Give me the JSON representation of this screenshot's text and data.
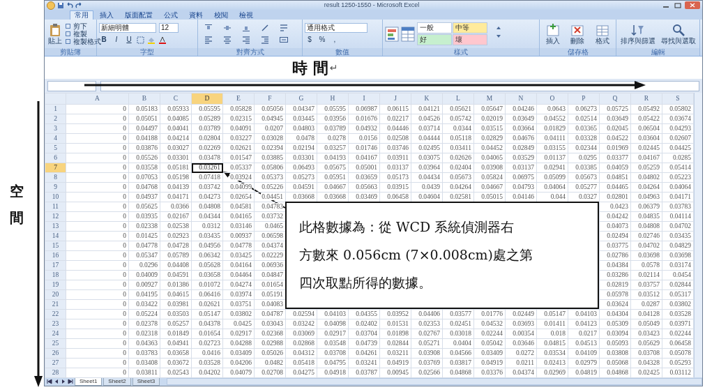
{
  "window": {
    "title": "result 1250-1550 - Microsoft Excel"
  },
  "ribbon": {
    "tabs": [
      {
        "label": "常用",
        "selected": true
      },
      {
        "label": "插入",
        "selected": false
      },
      {
        "label": "版面配置",
        "selected": false
      },
      {
        "label": "公式",
        "selected": false
      },
      {
        "label": "資料",
        "selected": false
      },
      {
        "label": "校閱",
        "selected": false
      },
      {
        "label": "檢視",
        "selected": false
      }
    ],
    "clipboard": {
      "label": "剪貼簿",
      "paste": "貼上",
      "items": [
        "剪下",
        "複製",
        "複製格式"
      ]
    },
    "font": {
      "label": "字型",
      "name": "新細明體",
      "size": "12",
      "styles": [
        "B",
        "I",
        "U"
      ]
    },
    "alignment": {
      "label": "對齊方式"
    },
    "number": {
      "label": "數值",
      "format": "通用格式",
      "symbols": [
        "$",
        "%",
        ","
      ]
    },
    "styles": {
      "label": "樣式",
      "cells": [
        {
          "label": "一般",
          "color": "#ffffff"
        },
        {
          "label": "中等",
          "color": "#ffeb9c"
        },
        {
          "label": "好",
          "color": "#c6efce"
        },
        {
          "label": "壞",
          "color": "#ffc7ce"
        }
      ]
    },
    "cells": {
      "label": "儲存格",
      "buttons": [
        "插入",
        "刪除",
        "格式"
      ]
    },
    "editing": {
      "label": "編輯",
      "buttons": [
        "排序與篩選",
        "尋找與選取"
      ]
    }
  },
  "annotations": {
    "horizontal_label": "時 間",
    "paragraph_mark": "↵",
    "vertical_label": "空間"
  },
  "callout": {
    "lines": [
      "此格數據為：從 WCD 系統偵測器右",
      "方數來 0.056cm (7×0.008cm)處之第",
      "四次取點所得的數據。"
    ]
  },
  "sheet": {
    "columns": [
      {
        "label": "A",
        "selected": false
      },
      {
        "label": "B",
        "selected": false
      },
      {
        "label": "C",
        "selected": false
      },
      {
        "label": "D",
        "selected": true
      },
      {
        "label": "E",
        "selected": false
      },
      {
        "label": "F",
        "selected": false
      },
      {
        "label": "G",
        "selected": false
      },
      {
        "label": "H",
        "selected": false
      },
      {
        "label": "I",
        "selected": false
      },
      {
        "label": "J",
        "selected": false
      },
      {
        "label": "K",
        "selected": false
      },
      {
        "label": "L",
        "selected": false
      },
      {
        "label": "M",
        "selected": false
      },
      {
        "label": "N",
        "selected": false
      },
      {
        "label": "O",
        "selected": false
      },
      {
        "label": "P",
        "selected": false
      },
      {
        "label": "Q",
        "selected": false
      },
      {
        "label": "R",
        "selected": false
      },
      {
        "label": "S",
        "selected": false
      }
    ],
    "rows": [
      {
        "number": "1",
        "selected": false,
        "cells": [
          "0",
          "0.05183",
          "0.05933",
          "0.05595",
          "0.05828",
          "0.05056",
          "0.04347",
          "0.05595",
          "0.06987",
          "0.06115",
          "0.04121",
          "0.05621",
          "0.05647",
          "0.04246",
          "0.0643",
          "0.06273",
          "0.05725",
          "0.05492",
          "0.05802"
        ]
      },
      {
        "number": "2",
        "selected": false,
        "cells": [
          "0",
          "0.05051",
          "0.04085",
          "0.05289",
          "0.02315",
          "0.04945",
          "0.03445",
          "0.03956",
          "0.01676",
          "0.02217",
          "0.04526",
          "0.05742",
          "0.02019",
          "0.03649",
          "0.04552",
          "0.02514",
          "0.03649",
          "0.05422",
          "0.03674"
        ]
      },
      {
        "number": "3",
        "selected": false,
        "cells": [
          "0",
          "0.04497",
          "0.04041",
          "0.03789",
          "0.04091",
          "0.0207",
          "0.04803",
          "0.03789",
          "0.04932",
          "0.04446",
          "0.03714",
          "0.0344",
          "0.03515",
          "0.03664",
          "0.01829",
          "0.03365",
          "0.02045",
          "0.06504",
          "0.04293"
        ]
      },
      {
        "number": "4",
        "selected": false,
        "cells": [
          "0",
          "0.04188",
          "0.04214",
          "0.02804",
          "0.03227",
          "0.03028",
          "0.0478",
          "0.0278",
          "0.0156",
          "0.02508",
          "0.04444",
          "0.05118",
          "0.02829",
          "0.04676",
          "0.04111",
          "0.03328",
          "0.04522",
          "0.03604",
          "0.02607"
        ]
      },
      {
        "number": "5",
        "selected": false,
        "cells": [
          "0",
          "0.03876",
          "0.03027",
          "0.02269",
          "0.02621",
          "0.02394",
          "0.02194",
          "0.03257",
          "0.01746",
          "0.03746",
          "0.02495",
          "0.03411",
          "0.04452",
          "0.02849",
          "0.03155",
          "0.02344",
          "0.01969",
          "0.02445",
          "0.04425"
        ]
      },
      {
        "number": "6",
        "selected": false,
        "cells": [
          "0",
          "0.05526",
          "0.03301",
          "0.03478",
          "0.01547",
          "0.03885",
          "0.03301",
          "0.04193",
          "0.04167",
          "0.03911",
          "0.03075",
          "0.02626",
          "0.04065",
          "0.03529",
          "0.01137",
          "0.0295",
          "0.03377",
          "0.04167",
          "0.0285"
        ]
      },
      {
        "number": "7",
        "selected": true,
        "cells": [
          "0",
          "0.03558",
          "0.05181",
          "0.03261",
          "0.05337",
          "0.05806",
          "0.06493",
          "0.05675",
          "0.05001",
          "0.03137",
          "0.03964",
          "0.02404",
          "0.03908",
          "0.03137",
          "0.02941",
          "0.03385",
          "0.04059",
          "0.05259",
          "0.05414"
        ]
      },
      {
        "number": "8",
        "selected": false,
        "cells": [
          "0",
          "0.07053",
          "0.05198",
          "0.07418",
          "0.03924",
          "0.05373",
          "0.05273",
          "0.05951",
          "0.03659",
          "0.05173",
          "0.04434",
          "0.05673",
          "0.05824",
          "0.06975",
          "0.05099",
          "0.05673",
          "0.04851",
          "0.04802",
          "0.05223"
        ]
      },
      {
        "number": "9",
        "selected": false,
        "cells": [
          "0",
          "0.04768",
          "0.04139",
          "0.03742",
          "0.04099",
          "0.05226",
          "0.04591",
          "0.04667",
          "0.05663",
          "0.03915",
          "0.0439",
          "0.04264",
          "0.04667",
          "0.04793",
          "0.04064",
          "0.05277",
          "0.04465",
          "0.04264",
          "0.04064"
        ]
      },
      {
        "number": "10",
        "selected": false,
        "cells": [
          "0",
          "0.04937",
          "0.04171",
          "0.04273",
          "0.02654",
          "0.04451",
          "0.03668",
          "0.03668",
          "0.03469",
          "0.06458",
          "0.04604",
          "0.02581",
          "0.05015",
          "0.04146",
          "0.044",
          "0.0327",
          "0.02801",
          "0.04963",
          "0.04171"
        ]
      },
      {
        "number": "11",
        "selected": false,
        "cells": [
          "0",
          "0.05625",
          "0.0366",
          "0.04808",
          "0.04581",
          "0.04783",
          null,
          null,
          null,
          null,
          null,
          null,
          null,
          null,
          null,
          null,
          "0.0423",
          "0.06379",
          "0.03783"
        ]
      },
      {
        "number": "12",
        "selected": false,
        "cells": [
          "0",
          "0.03935",
          "0.02167",
          "0.04344",
          "0.04165",
          "0.03732",
          null,
          null,
          null,
          null,
          null,
          null,
          null,
          null,
          null,
          null,
          "0.04242",
          "0.04835",
          "0.04114"
        ]
      },
      {
        "number": "13",
        "selected": false,
        "cells": [
          "0",
          "0.02338",
          "0.02538",
          "0.0312",
          "0.03146",
          "0.0465",
          null,
          null,
          null,
          null,
          null,
          null,
          null,
          null,
          null,
          null,
          "0.04073",
          "0.04808",
          "0.04702"
        ]
      },
      {
        "number": "14",
        "selected": false,
        "cells": [
          "0",
          "0.01425",
          "0.02923",
          "0.03435",
          "0.00937",
          "0.06598",
          null,
          null,
          null,
          null,
          null,
          null,
          null,
          null,
          null,
          null,
          "0.02494",
          "0.02746",
          "0.03435"
        ]
      },
      {
        "number": "15",
        "selected": false,
        "cells": [
          "0",
          "0.04778",
          "0.04728",
          "0.04956",
          "0.04778",
          "0.04374",
          null,
          null,
          null,
          null,
          null,
          null,
          null,
          null,
          null,
          null,
          "0.03775",
          "0.04702",
          "0.04829"
        ]
      },
      {
        "number": "16",
        "selected": false,
        "cells": [
          "0",
          "0.05347",
          "0.05789",
          "0.06342",
          "0.03425",
          "0.02229",
          null,
          null,
          null,
          null,
          null,
          null,
          null,
          null,
          null,
          null,
          "0.02786",
          "0.03698",
          "0.03698"
        ]
      },
      {
        "number": "17",
        "selected": false,
        "cells": [
          "0",
          "0.0296",
          "0.04408",
          "0.05628",
          "0.04164",
          "0.06936",
          null,
          null,
          null,
          null,
          null,
          null,
          null,
          null,
          null,
          null,
          "0.04384",
          "0.0578",
          "0.03174"
        ]
      },
      {
        "number": "18",
        "selected": false,
        "cells": [
          "0",
          "0.04009",
          "0.04591",
          "0.03658",
          "0.04464",
          "0.04847",
          null,
          null,
          null,
          null,
          null,
          null,
          null,
          null,
          null,
          null,
          "0.03286",
          "0.02114",
          "0.0454"
        ]
      },
      {
        "number": "19",
        "selected": false,
        "cells": [
          "0",
          "0.00927",
          "0.01386",
          "0.01072",
          "0.04274",
          "0.01654",
          null,
          null,
          null,
          null,
          null,
          null,
          null,
          null,
          null,
          null,
          "0.02819",
          "0.03757",
          "0.02844"
        ]
      },
      {
        "number": "20",
        "selected": false,
        "cells": [
          "0",
          "0.04195",
          "0.04615",
          "0.06416",
          "0.03974",
          "0.05191",
          null,
          null,
          null,
          null,
          null,
          null,
          null,
          null,
          null,
          null,
          "0.05978",
          "0.03512",
          "0.05317"
        ]
      },
      {
        "number": "21",
        "selected": false,
        "cells": [
          "0",
          "0.03422",
          "0.03981",
          "0.02621",
          "0.03751",
          "0.04083",
          null,
          null,
          null,
          null,
          null,
          null,
          null,
          null,
          null,
          null,
          "0.03624",
          "0.0287",
          "0.03802"
        ]
      },
      {
        "number": "22",
        "selected": false,
        "cells": [
          "0",
          "0.05224",
          "0.03503",
          "0.05147",
          "0.03802",
          "0.04787",
          "0.02594",
          "0.04103",
          "0.04355",
          "0.03952",
          "0.04406",
          "0.03577",
          "0.01776",
          "0.02449",
          "0.05147",
          "0.04103",
          "0.04304",
          "0.04128",
          "0.03528"
        ]
      },
      {
        "number": "23",
        "selected": false,
        "cells": [
          "0",
          "0.02378",
          "0.05257",
          "0.04378",
          "0.0425",
          "0.03043",
          "0.03242",
          "0.04098",
          "0.02402",
          "0.01531",
          "0.02353",
          "0.02451",
          "0.04532",
          "0.03693",
          "0.01411",
          "0.04123",
          "0.05309",
          "0.05049",
          "0.03971"
        ]
      },
      {
        "number": "24",
        "selected": false,
        "cells": [
          "0",
          "0.02318",
          "0.01849",
          "0.01654",
          "0.02917",
          "0.02368",
          "0.03069",
          "0.02917",
          "0.03704",
          "0.01898",
          "0.02767",
          "0.03018",
          "0.02244",
          "0.00354",
          "0.018",
          "0.0217",
          "0.03094",
          "0.03423",
          "0.02244"
        ]
      },
      {
        "number": "25",
        "selected": false,
        "cells": [
          "0",
          "0.04363",
          "0.04941",
          "0.02723",
          "0.04288",
          "0.02988",
          "0.02868",
          "0.03548",
          "0.04739",
          "0.02844",
          "0.05271",
          "0.0404",
          "0.05042",
          "0.03646",
          "0.04815",
          "0.04513",
          "0.05093",
          "0.05629",
          "0.06458"
        ]
      },
      {
        "number": "26",
        "selected": false,
        "cells": [
          "0",
          "0.03783",
          "0.03658",
          "0.0416",
          "0.03409",
          "0.05026",
          "0.04312",
          "0.03708",
          "0.04261",
          "0.03211",
          "0.03908",
          "0.04566",
          "0.03409",
          "0.0272",
          "0.03534",
          "0.04109",
          "0.03808",
          "0.03708",
          "0.05078"
        ]
      },
      {
        "number": "27",
        "selected": false,
        "cells": [
          "0",
          "0.03408",
          "0.03672",
          "0.03528",
          "0.04206",
          "0.0482",
          "0.05418",
          "0.04795",
          "0.03241",
          "0.04919",
          "0.03769",
          "0.03817",
          "0.04919",
          "0.0211",
          "0.02413",
          "0.02979",
          "0.05068",
          "0.04328",
          "0.05293"
        ]
      },
      {
        "number": "28",
        "selected": false,
        "cells": [
          "0",
          "0.03811",
          "0.02543",
          "0.04202",
          "0.04079",
          "0.02708",
          "0.04275",
          "0.04918",
          "0.03787",
          "0.00945",
          "0.02566",
          "0.04868",
          "0.03376",
          "0.04374",
          "0.02969",
          "0.04819",
          "0.04868",
          "0.02425",
          "0.03112"
        ]
      }
    ]
  },
  "sheet_tabs": [
    {
      "label": "Sheet1",
      "selected": true
    },
    {
      "label": "Sheet2",
      "selected": false
    },
    {
      "label": "Sheet3",
      "selected": false
    }
  ]
}
